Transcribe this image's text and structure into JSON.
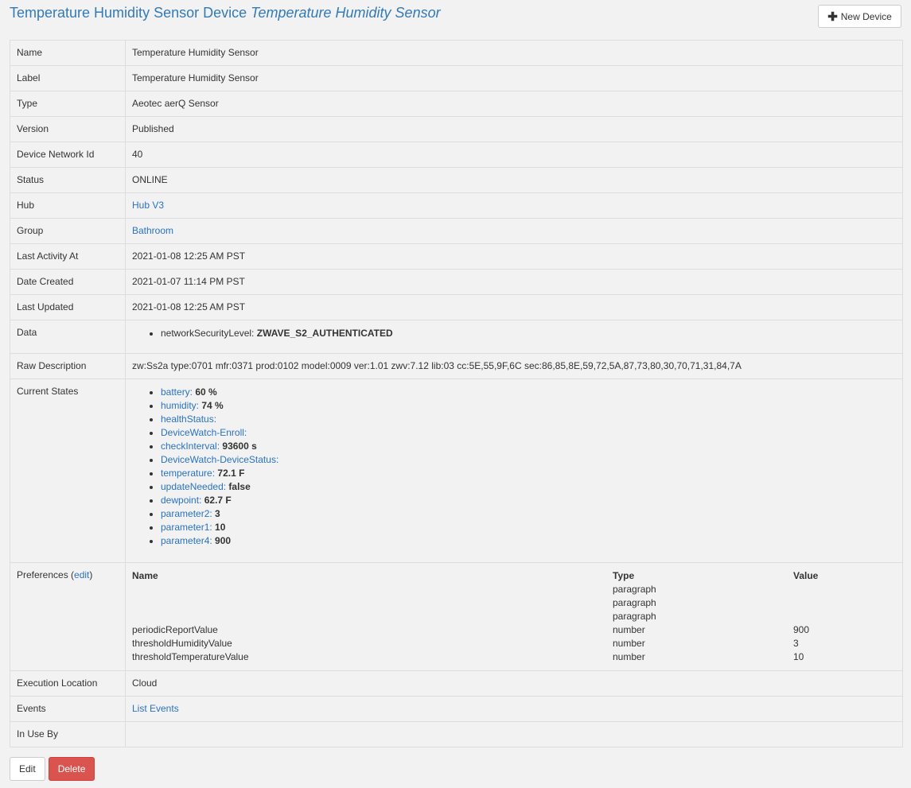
{
  "header": {
    "title": "Temperature Humidity Sensor Device",
    "title_italic": "Temperature Humidity Sensor",
    "new_device": "New Device"
  },
  "rows": {
    "name": {
      "label": "Name",
      "value": "Temperature Humidity Sensor"
    },
    "label": {
      "label": "Label",
      "value": "Temperature Humidity Sensor"
    },
    "type": {
      "label": "Type",
      "value": "Aeotec aerQ Sensor"
    },
    "version": {
      "label": "Version",
      "value": "Published"
    },
    "dni": {
      "label": "Device Network Id",
      "value": "40"
    },
    "status": {
      "label": "Status",
      "value": "ONLINE"
    },
    "hub": {
      "label": "Hub",
      "value": "Hub V3"
    },
    "group": {
      "label": "Group",
      "value": "Bathroom"
    },
    "last_activity": {
      "label": "Last Activity At",
      "value": "2021-01-08 12:25 AM PST"
    },
    "date_created": {
      "label": "Date Created",
      "value": "2021-01-07 11:14 PM PST"
    },
    "last_updated": {
      "label": "Last Updated",
      "value": "2021-01-08 12:25 AM PST"
    },
    "data": {
      "label": "Data",
      "key": "networkSecurityLevel:",
      "value": "ZWAVE_S2_AUTHENTICATED"
    },
    "raw": {
      "label": "Raw Description",
      "value": "zw:Ss2a type:0701 mfr:0371 prod:0102 model:0009 ver:1.01 zwv:7.12 lib:03 cc:5E,55,9F,6C sec:86,85,8E,59,72,5A,87,73,80,30,70,71,31,84,7A"
    },
    "states_label": "Current States",
    "prefs": {
      "label": "Preferences (",
      "edit": "edit",
      "close": ")",
      "col_name": "Name",
      "col_type": "Type",
      "col_value": "Value"
    },
    "exec": {
      "label": "Execution Location",
      "value": "Cloud"
    },
    "events": {
      "label": "Events",
      "value": "List Events"
    },
    "inuse": {
      "label": "In Use By"
    }
  },
  "states": [
    {
      "k": "battery:",
      "v": "60 %"
    },
    {
      "k": "humidity:",
      "v": "74 %"
    },
    {
      "k": "healthStatus:",
      "v": ""
    },
    {
      "k": "DeviceWatch-Enroll:",
      "v": ""
    },
    {
      "k": "checkInterval:",
      "v": "93600 s"
    },
    {
      "k": "DeviceWatch-DeviceStatus:",
      "v": ""
    },
    {
      "k": "temperature:",
      "v": "72.1 F"
    },
    {
      "k": "updateNeeded:",
      "v": "false"
    },
    {
      "k": "dewpoint:",
      "v": "62.7 F"
    },
    {
      "k": "parameter2:",
      "v": "3"
    },
    {
      "k": "parameter1:",
      "v": "10"
    },
    {
      "k": "parameter4:",
      "v": "900"
    }
  ],
  "preferences": [
    {
      "name": "",
      "type": "paragraph",
      "value": ""
    },
    {
      "name": "",
      "type": "paragraph",
      "value": ""
    },
    {
      "name": "",
      "type": "paragraph",
      "value": ""
    },
    {
      "name": "periodicReportValue",
      "type": "number",
      "value": "900"
    },
    {
      "name": "thresholdHumidityValue",
      "type": "number",
      "value": "3"
    },
    {
      "name": "thresholdTemperatureValue",
      "type": "number",
      "value": "10"
    }
  ],
  "actions": {
    "edit": "Edit",
    "delete": "Delete"
  }
}
